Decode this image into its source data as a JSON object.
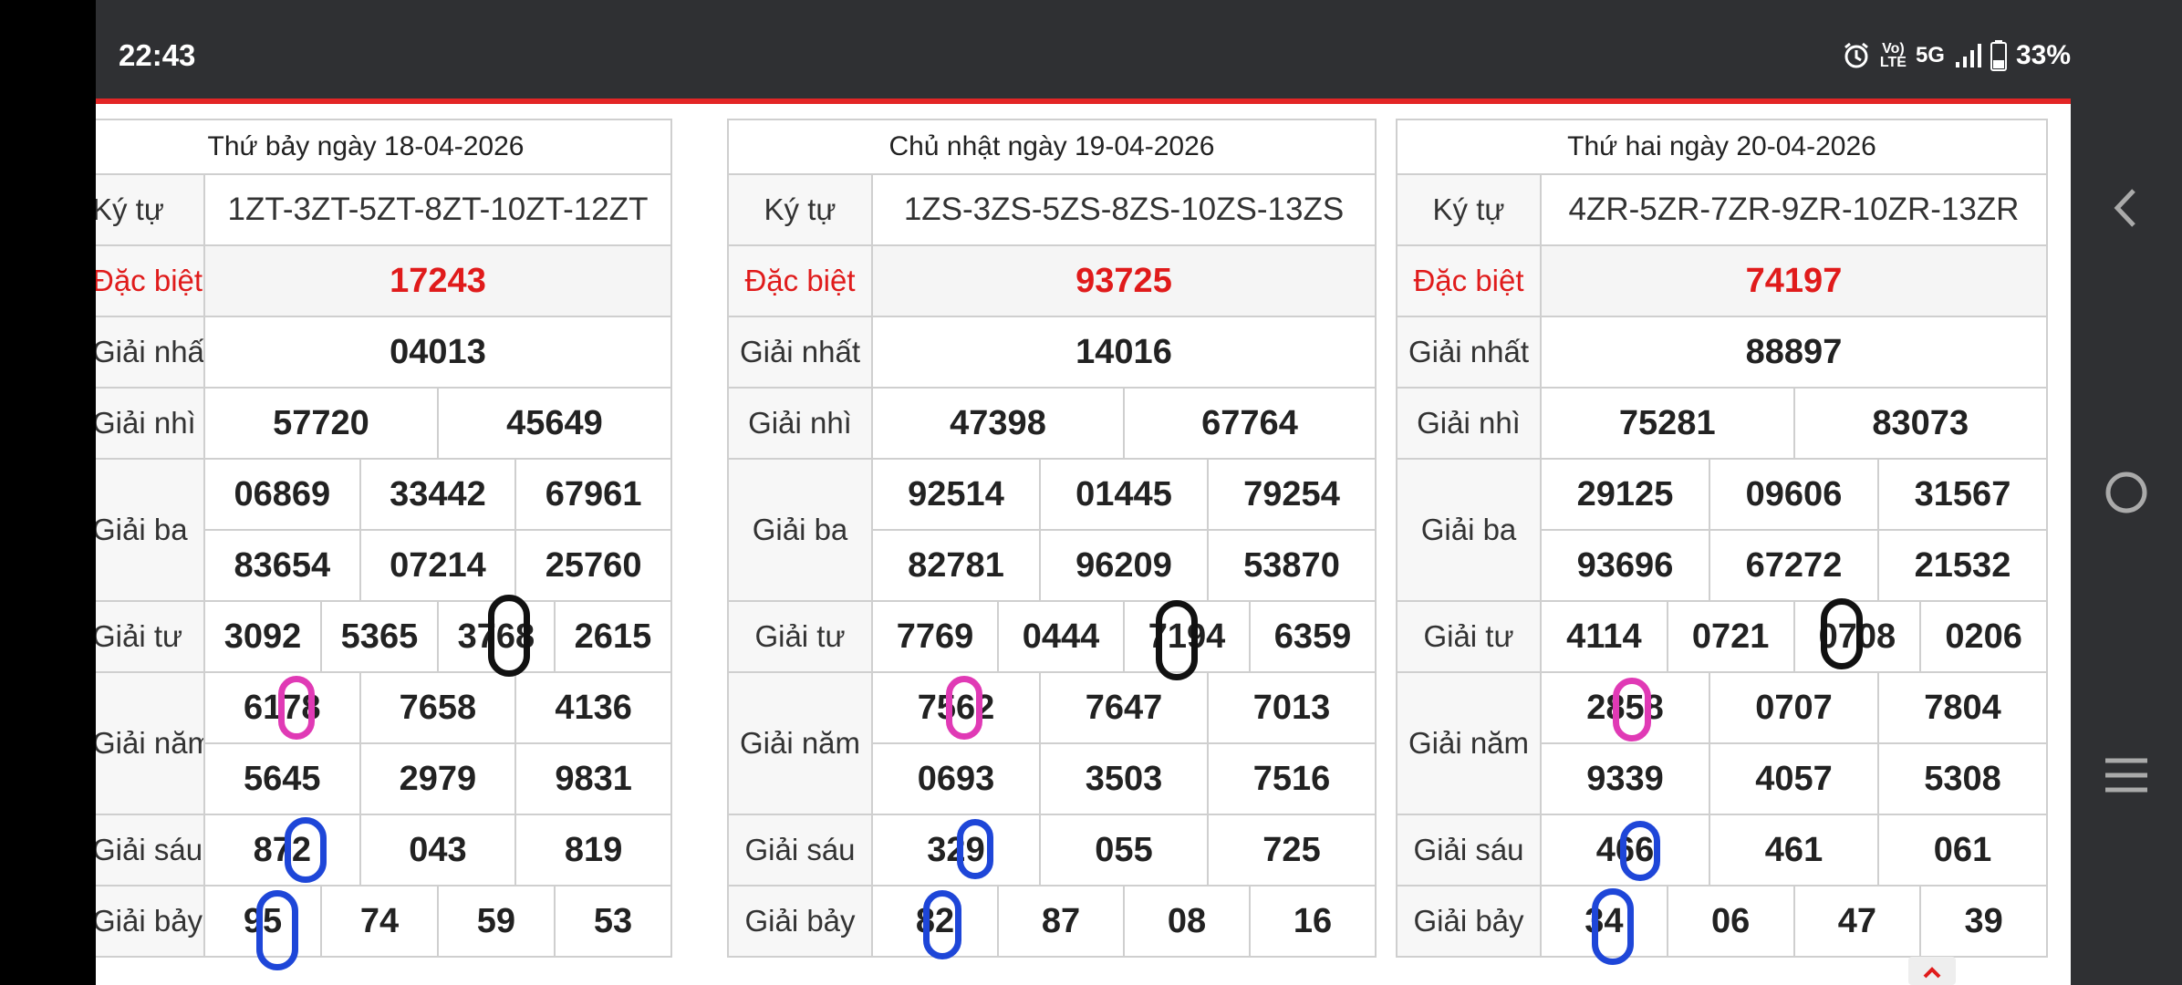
{
  "status_bar": {
    "time": "22:43",
    "network": "5G",
    "battery": "33%",
    "icons": [
      "alarm-icon",
      "volte-icon",
      "signal-icon",
      "battery-icon"
    ]
  },
  "nav_bar": {
    "icons": [
      "back-icon",
      "home-icon",
      "recents-icon"
    ]
  },
  "columns": [
    {
      "date": "Thứ bảy ngày 18-04-2026",
      "ky_tu_label": "Ký tự",
      "ky_tu": "1ZT-3ZT-5ZT-8ZT-10ZT-12ZT",
      "labels": [
        "Đặc biệt",
        "Giải nhất",
        "Giải nhì",
        "Giải ba",
        "Giải tư",
        "Giải năm",
        "Giải sáu",
        "Giải bảy"
      ],
      "dac_biet": "17243",
      "giai_nhat": "04013",
      "giai_nhi": [
        "57720",
        "45649"
      ],
      "giai_ba": [
        "06869",
        "33442",
        "67961",
        "83654",
        "07214",
        "25760"
      ],
      "giai_tu": [
        "3092",
        "5365",
        "3768",
        "2615"
      ],
      "giai_nam": [
        "6178",
        "7658",
        "4136",
        "5645",
        "2979",
        "9831"
      ],
      "giai_sau": [
        "872",
        "043",
        "819"
      ],
      "giai_bay": [
        "95",
        "74",
        "59",
        "53"
      ]
    },
    {
      "date": "Chủ nhật ngày 19-04-2026",
      "ky_tu_label": "Ký tự",
      "ky_tu": "1ZS-3ZS-5ZS-8ZS-10ZS-13ZS",
      "labels": [
        "Đặc biệt",
        "Giải nhất",
        "Giải nhì",
        "Giải ba",
        "Giải tư",
        "Giải năm",
        "Giải sáu",
        "Giải bảy"
      ],
      "dac_biet": "93725",
      "giai_nhat": "14016",
      "giai_nhi": [
        "47398",
        "67764"
      ],
      "giai_ba": [
        "92514",
        "01445",
        "79254",
        "82781",
        "96209",
        "53870"
      ],
      "giai_tu": [
        "7769",
        "0444",
        "7194",
        "6359"
      ],
      "giai_nam": [
        "7562",
        "7647",
        "7013",
        "0693",
        "3503",
        "7516"
      ],
      "giai_sau": [
        "329",
        "055",
        "725"
      ],
      "giai_bay": [
        "82",
        "87",
        "08",
        "16"
      ]
    },
    {
      "date": "Thứ hai ngày 20-04-2026",
      "ky_tu_label": "Ký tự",
      "ky_tu": "4ZR-5ZR-7ZR-9ZR-10ZR-13ZR",
      "labels": [
        "Đặc biệt",
        "Giải nhất",
        "Giải nhì",
        "Giải ba",
        "Giải tư",
        "Giải năm",
        "Giải sáu",
        "Giải bảy"
      ],
      "dac_biet": "74197",
      "giai_nhat": "88897",
      "giai_nhi": [
        "75281",
        "83073"
      ],
      "giai_ba": [
        "29125",
        "09606",
        "31567",
        "93696",
        "67272",
        "21532"
      ],
      "giai_tu": [
        "4114",
        "0721",
        "0708",
        "0206"
      ],
      "giai_nam": [
        "2858",
        "0707",
        "7804",
        "9339",
        "4057",
        "5308"
      ],
      "giai_sau": [
        "466",
        "461",
        "061"
      ],
      "giai_bay": [
        "34",
        "06",
        "47",
        "39"
      ]
    }
  ]
}
